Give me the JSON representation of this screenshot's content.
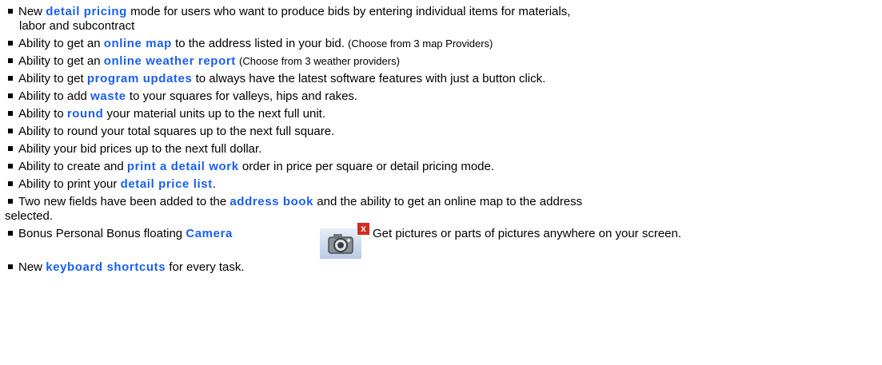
{
  "colors": {
    "link": "#1a5ff0",
    "text": "#000000",
    "close_red": "#d42a20"
  },
  "items": [
    {
      "pre": "New ",
      "link": "detail pricing",
      "post": " mode for users who want to produce bids by entering individual items  for materials,",
      "cont": "labor and subcontract"
    },
    {
      "pre": "Ability to get an ",
      "link": "online map",
      "post": " to the address listed in your bid. ",
      "note": "(Choose from 3 map Providers)"
    },
    {
      "pre": "Ability to get an ",
      "link": "online weather report",
      "post": " ",
      "note": "(Choose from 3 weather providers)"
    },
    {
      "pre": "Ability to get ",
      "link": "program updates",
      "post": " to always have the latest software features with just a button click."
    },
    {
      "pre": "Ability to add ",
      "link": "waste",
      "post": " to your squares for valleys, hips and rakes."
    },
    {
      "pre": "Ability to ",
      "link": "round",
      "post": " your material units up to the next full unit."
    },
    {
      "pre": "Ability to round your total squares up to the next full square."
    },
    {
      "pre": "Ability your bid prices up to the next full dollar."
    },
    {
      "pre": "Ability to create and ",
      "link": "print a detail work",
      "post": " order in price per square or detail pricing mode."
    },
    {
      "pre": "Ability to print your ",
      "link": "detail price list",
      "post": "."
    },
    {
      "pre": "Two new fields  have been added to the ",
      "link": "address book",
      "post": " and the ability to get an online map to the address",
      "cont": "selected."
    },
    {
      "pre": "Bonus Personal Bonus floating ",
      "link": "Camera",
      "post": "Get pictures or parts of pictures anywhere on your screen."
    },
    {
      "pre": "New ",
      "link": "keyboard shortcuts",
      "post": " for every task."
    }
  ],
  "camera_icon": {
    "icon": "camera-icon",
    "close_icon": "close-icon",
    "close_glyph": "x"
  }
}
